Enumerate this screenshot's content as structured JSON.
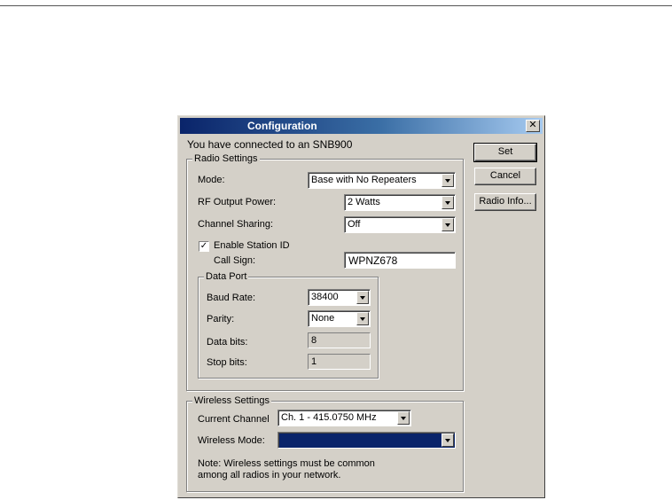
{
  "window": {
    "title": "Configuration",
    "close_glyph": "✕",
    "connected_text": "You have connected to an SNB900"
  },
  "buttons": {
    "set": "Set",
    "cancel": "Cancel",
    "radio_info": "Radio Info..."
  },
  "radio_settings": {
    "legend": "Radio Settings",
    "mode_label": "Mode:",
    "mode_value": "Base with No Repeaters",
    "rf_power_label": "RF Output Power:",
    "rf_power_value": "2 Watts",
    "channel_sharing_label": "Channel Sharing:",
    "channel_sharing_value": "Off",
    "station_id_label": "Enable Station ID",
    "station_id_checked": true,
    "station_id_check_glyph": "✓",
    "call_sign_label": "Call Sign:",
    "call_sign_value": "WPNZ678"
  },
  "data_port": {
    "legend": "Data Port",
    "baud_label": "Baud Rate:",
    "baud_value": "38400",
    "parity_label": "Parity:",
    "parity_value": "None",
    "data_bits_label": "Data bits:",
    "data_bits_value": "8",
    "stop_bits_label": "Stop bits:",
    "stop_bits_value": "1"
  },
  "wireless_settings": {
    "legend": "Wireless Settings",
    "channel_label": "Current Channel",
    "channel_value": "Ch.  1 - 415.0750 MHz",
    "mode_label": "Wireless Mode:",
    "mode_value": "",
    "note_line1": "Note: Wireless settings must be common",
    "note_line2": "among all radios in your network."
  },
  "colors": {
    "dialog_face": "#d4d0c8",
    "titlebar_start": "#0a246a",
    "titlebar_end": "#a6caf0",
    "selection_blue": "#0a246a"
  }
}
